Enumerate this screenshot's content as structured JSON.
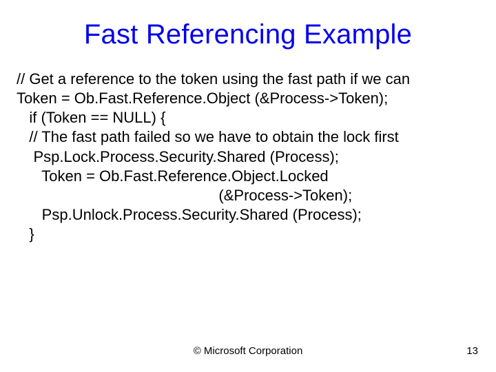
{
  "title": "Fast Referencing Example",
  "code": {
    "l1": "// Get a reference to the token using the fast path if we can",
    "l2": "Token = Ob.Fast.Reference.Object (&Process->Token);",
    "l3": "   if (Token == NULL) {",
    "l4": "   // The fast path failed so we have to obtain the lock first",
    "l5": "    Psp.Lock.Process.Security.Shared (Process);",
    "l6": "      Token = Ob.Fast.Reference.Object.Locked",
    "l7": "                                                (&Process->Token);",
    "l8": "      Psp.Unlock.Process.Security.Shared (Process);",
    "l9": "   }"
  },
  "footer": {
    "copyright": "© Microsoft Corporation",
    "page": "13"
  }
}
